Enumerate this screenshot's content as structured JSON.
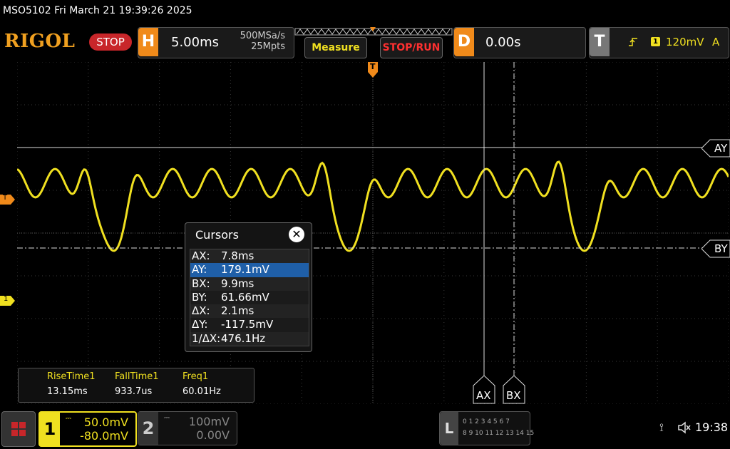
{
  "title_bar": {
    "text": "MSO5102  Fri March 21 19:39:26 2025"
  },
  "toolbar": {
    "logo": "RIGOL",
    "run_state": "STOP",
    "horizontal": {
      "badge": "H",
      "timebase": "5.00ms",
      "sample_rate": "500MSa/s",
      "memory_depth": "25Mpts"
    },
    "measure_label": "Measure",
    "stop_run_label": "STOP/RUN",
    "delay": {
      "badge": "D",
      "value": "0.00s"
    },
    "trigger": {
      "badge": "T",
      "source": "1",
      "level": "120mV",
      "mode": "A"
    }
  },
  "screen": {
    "trigger_pos_marker": "T",
    "left_trigger_marker": "T",
    "ch1_marker": "1",
    "cursor_labels": {
      "ay": "AY",
      "by": "BY",
      "ax": "AX",
      "bx": "BX"
    }
  },
  "cursors_panel": {
    "title": "Cursors",
    "close_icon": "close-icon",
    "rows": [
      {
        "key": "AX:",
        "value": "7.8ms"
      },
      {
        "key": "AY:",
        "value": "179.1mV"
      },
      {
        "key": "BX:",
        "value": "9.9ms"
      },
      {
        "key": "BY:",
        "value": "61.66mV"
      },
      {
        "key": "ΔX:",
        "value": "2.1ms"
      },
      {
        "key": "ΔY:",
        "value": "-117.5mV"
      },
      {
        "key": "1/ΔX:",
        "value": "476.1Hz"
      }
    ],
    "selected_row": 1
  },
  "measurements": [
    {
      "name": "RiseTime1",
      "value": "13.15ms"
    },
    {
      "name": "FallTime1",
      "value": "933.7us"
    },
    {
      "name": "Freq1",
      "value": "60.01Hz"
    }
  ],
  "bottom": {
    "ch1": {
      "num": "1",
      "scale": "50.0mV",
      "offset": "-80.0mV"
    },
    "ch2": {
      "num": "2",
      "scale": "100mV",
      "offset": "0.00V"
    },
    "logic": {
      "badge": "L",
      "row1": "0 1 2 3  4 5 6 7",
      "row2": "8 9 10 11 12 13 14 15"
    },
    "time": "19:38"
  },
  "colors": {
    "ch1": "#f0e020",
    "accent_orange": "#f08a1a",
    "stop_red": "#c8262a"
  },
  "icons": [
    "menu-grid-icon",
    "usb-icon",
    "speaker-mute-icon",
    "close-icon",
    "coupling-icon"
  ]
}
